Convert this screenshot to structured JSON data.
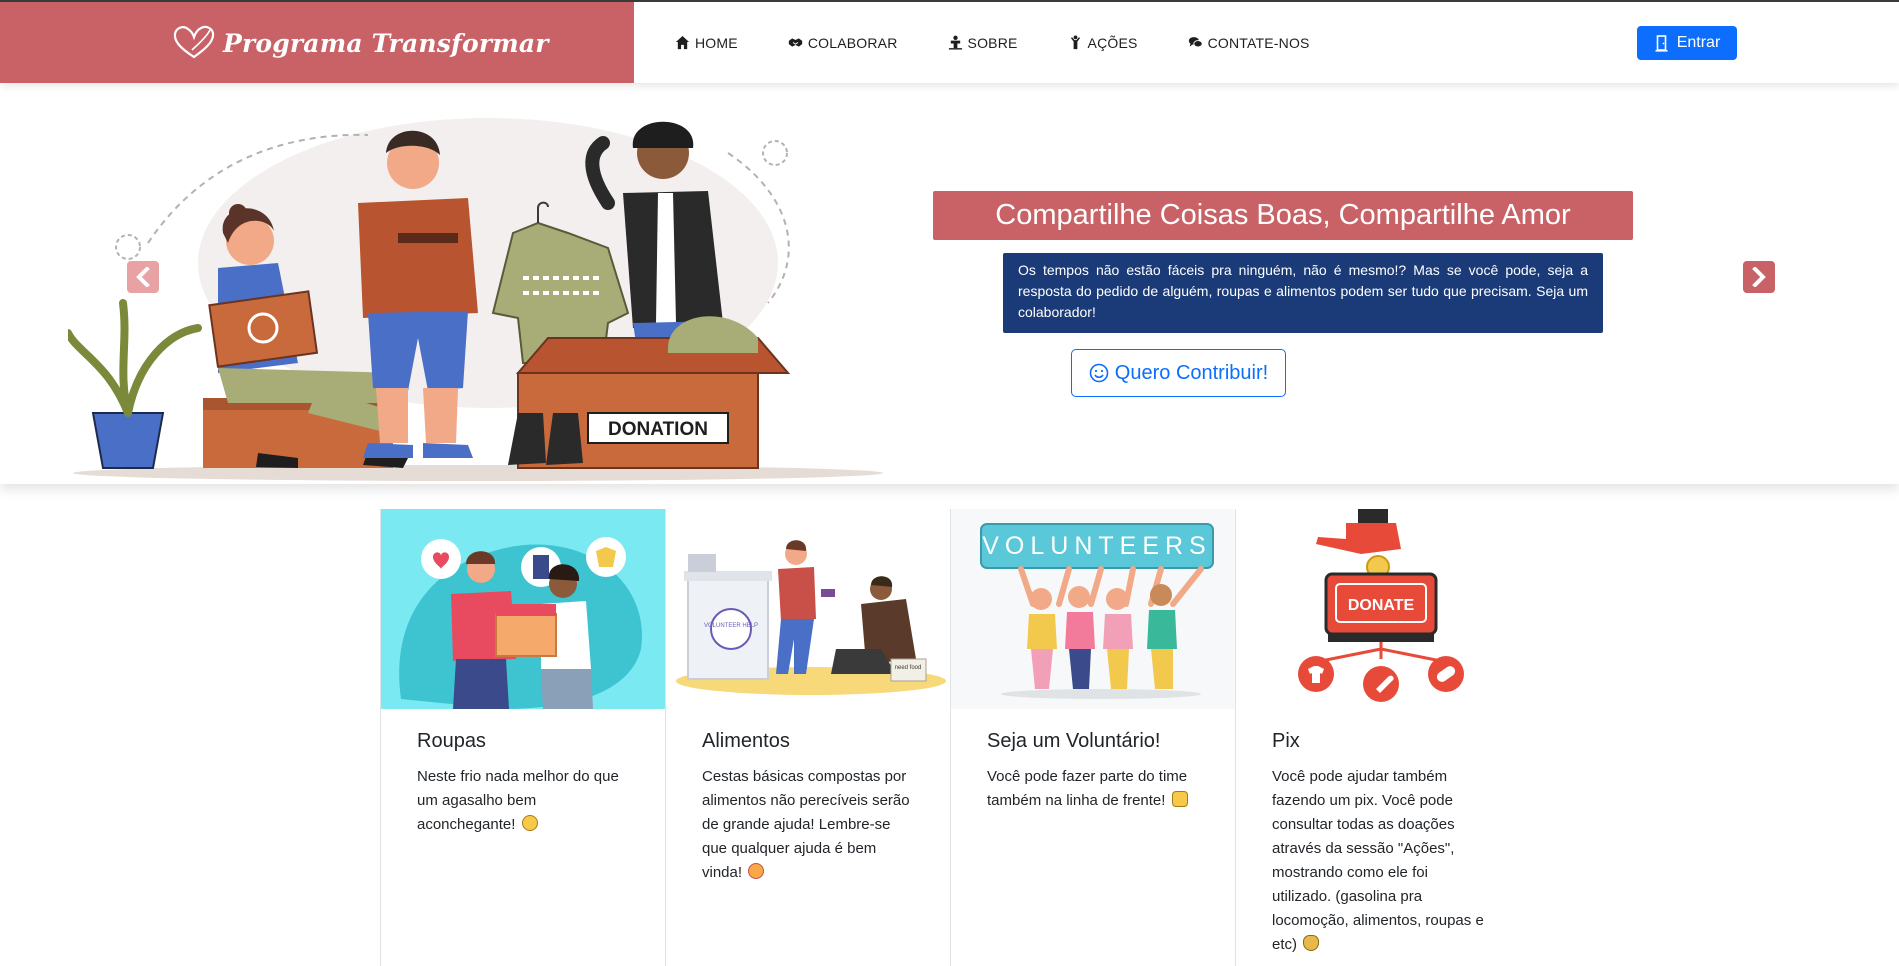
{
  "brand": {
    "name": "Programa Transformar",
    "logo_icon": "heart-outline-icon",
    "color": "#c96266"
  },
  "nav": {
    "items": [
      {
        "label": "HOME",
        "icon": "home-icon"
      },
      {
        "label": "COLABORAR",
        "icon": "handshake-icon"
      },
      {
        "label": "SOBRE",
        "icon": "person-chalkboard-icon"
      },
      {
        "label": "AÇÕES",
        "icon": "person-hands-icon"
      },
      {
        "label": "CONTATE-NOS",
        "icon": "chat-bubbles-icon"
      }
    ],
    "login_label": "Entrar",
    "login_icon": "door-icon",
    "login_color": "#0d6efd"
  },
  "hero": {
    "title": "Compartilhe Coisas Boas, Compartilhe Amor",
    "text": "Os tempos não estão fáceis pra ninguém, não é mesmo!? Mas se você pode, seja a resposta do pedido de alguém, roupas e alimentos podem ser tudo que precisam. Seja um colaborador!",
    "cta_label": "Quero Contribuir!",
    "cta_icon": "smile-icon",
    "illustration_label": "DONATION",
    "title_bg": "#c96266",
    "text_bg": "#1a3b78"
  },
  "cards": [
    {
      "title": "Roupas",
      "text": "Neste frio nada melhor do que um agasalho bem aconchegante!",
      "emoji": "grin-emoji",
      "image": "clothes-donation-illustration"
    },
    {
      "title": "Alimentos",
      "text": "Cestas básicas compostas por alimentos não perecíveis serão de grande ajuda! Lembre-se que qualquer ajuda é bem vinda!",
      "emoji": "hearts-face-emoji",
      "image": "food-volunteer-illustration",
      "image_labels": [
        "VOLUNTEER HELP",
        "need food"
      ]
    },
    {
      "title": "Seja um Voluntário!",
      "text": "Você pode fazer parte do time também na linha de frente!",
      "emoji": "fist-bump-emoji",
      "image": "volunteers-illustration",
      "image_label": "VOLUNTEERS"
    },
    {
      "title": "Pix",
      "text": "Você pode ajudar também fazendo um pix. Você pode consultar todas as doações através da sessão \"Ações\", mostrando como ele foi utilizado. (gasolina pra locomoção, alimentos, roupas e etc)",
      "emoji": "money-bag-emoji",
      "image": "donate-box-illustration",
      "image_label": "DONATE"
    }
  ]
}
